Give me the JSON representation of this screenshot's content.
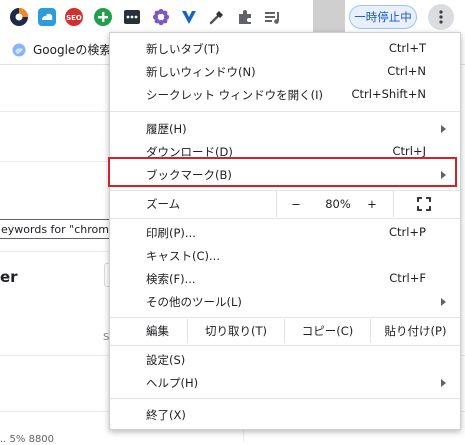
{
  "toolbar": {
    "extensions": [
      "circle-logo-icon",
      "cloud-icon",
      "seo-icon",
      "plus-circle-icon",
      "dots-box-icon",
      "flower-icon",
      "y-shield-icon",
      "eyedropper-icon",
      "puzzle-icon",
      "playlist-icon"
    ],
    "pause_label": "一時停止中",
    "seo_label": "SEO"
  },
  "bookmarks_bar": {
    "item_label": "Googleの検索"
  },
  "page": {
    "keywords_text": "eywords for \"chrome お",
    "side_text": "er",
    "s_text": "S",
    "bottom_text": "..        5%      8800"
  },
  "menu": {
    "new_tab": {
      "label": "新しいタブ(T)",
      "shortcut": "Ctrl+T"
    },
    "new_window": {
      "label": "新しいウィンドウ(N)",
      "shortcut": "Ctrl+N"
    },
    "incognito": {
      "label": "シークレット ウィンドウを開く(I)",
      "shortcut": "Ctrl+Shift+N"
    },
    "history": {
      "label": "履歴(H)"
    },
    "downloads": {
      "label": "ダウンロード(D)",
      "shortcut": "Ctrl+J"
    },
    "bookmarks": {
      "label": "ブックマーク(B)"
    },
    "zoom": {
      "label": "ズーム",
      "minus": "−",
      "value": "80%",
      "plus": "+"
    },
    "print": {
      "label": "印刷(P)...",
      "shortcut": "Ctrl+P"
    },
    "cast": {
      "label": "キャスト(C)..."
    },
    "find": {
      "label": "検索(F)...",
      "shortcut": "Ctrl+F"
    },
    "more_tools": {
      "label": "その他のツール(L)"
    },
    "edit": {
      "label": "編集",
      "cut": "切り取り(T)",
      "copy": "コピー(C)",
      "paste": "貼り付け(P)"
    },
    "settings": {
      "label": "設定(S)"
    },
    "help": {
      "label": "ヘルプ(H)"
    },
    "exit": {
      "label": "終了(X)"
    }
  },
  "colors": {
    "highlight_border": "#d9202a",
    "pause_text": "#1a58c7",
    "pause_bg": "#e8f0fe"
  }
}
